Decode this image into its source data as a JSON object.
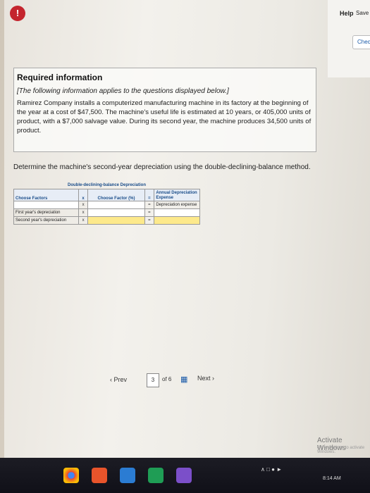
{
  "header": {
    "help_label": "Help",
    "save_label": "Save & E",
    "check_label": "Check"
  },
  "info": {
    "title": "Required information",
    "intro": "[The following information applies to the questions displayed below.]",
    "paragraph": "Ramirez Company installs a computerized manufacturing machine in its factory at the beginning of the year at a cost of $47,500. The machine's useful life is estimated at 10 years, or 405,000 units of product, with a $7,000 salvage value. During its second year, the machine produces 34,500 units of product."
  },
  "question": "Determine the machine's second-year depreciation using the double-declining-balance method.",
  "worksheet": {
    "title": "Double-declining-balance Depreciation",
    "headers": {
      "factors": "Choose Factors",
      "op1": "x",
      "factor_pct": "Choose Factor (%)",
      "op2": "=",
      "annual": "Annual Depreciation Expense"
    },
    "rows": [
      {
        "label": "",
        "op1": "x",
        "op2": "=",
        "result": "Depreciation expense"
      },
      {
        "label": "First year's depreciation",
        "op1": "x",
        "op2": "=",
        "result": ""
      },
      {
        "label": "Second year's depreciation",
        "op1": "x",
        "op2": "=",
        "result": ""
      }
    ]
  },
  "pager": {
    "prev_label": "Prev",
    "current_page": "3",
    "of_label": "of 6",
    "next_label": "Next"
  },
  "windows": {
    "activate_title": "Activate Windows",
    "activate_sub": "Go to Settings to activate Windows.",
    "time": "8:14 AM"
  }
}
